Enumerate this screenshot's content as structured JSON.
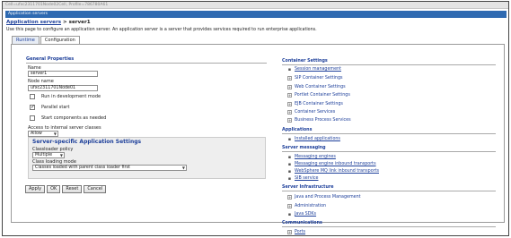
{
  "cell_path": "Cell=ufxc2311701Node02Cell, Profile=786780A61",
  "window_title": "Application servers",
  "breadcrumb": {
    "parent": "Application servers",
    "separator": " > ",
    "current": "server1"
  },
  "description": "Use this page to configure an application server. An application server is a server that provides services required to run enterprise applications.",
  "tabs": [
    {
      "label": "Runtime"
    },
    {
      "label": "Configuration"
    }
  ],
  "general": {
    "heading": "General Properties",
    "name_label": "Name",
    "name_value": "server1",
    "node_label": "Node name",
    "node_value": "ufxc2311701Node01",
    "dev_mode_label": "Run in development mode",
    "dev_mode_checked": false,
    "parallel_label": "Parallel start",
    "parallel_checked": true,
    "components_label": "Start components as needed",
    "components_checked": false,
    "access_label": "Access to internal server classes",
    "access_value": "Allow"
  },
  "server_specific": {
    "heading": "Server-specific Application Settings",
    "policy_label": "Classloader policy",
    "policy_value": "Multiple",
    "mode_label": "Class loading mode",
    "mode_value": "Classes loaded with parent class loader first"
  },
  "buttons": {
    "apply": "Apply",
    "ok": "OK",
    "reset": "Reset",
    "cancel": "Cancel"
  },
  "container_settings": {
    "heading": "Container Settings",
    "items": [
      {
        "label": "Session management",
        "type": "link"
      },
      {
        "label": "SIP Container Settings",
        "type": "expand"
      },
      {
        "label": "Web Container Settings",
        "type": "expand"
      },
      {
        "label": "Portlet Container Settings",
        "type": "expand"
      },
      {
        "label": "EJB Container Settings",
        "type": "expand"
      },
      {
        "label": "Container Services",
        "type": "expand"
      },
      {
        "label": "Business Process Services",
        "type": "expand"
      }
    ]
  },
  "applications": {
    "heading": "Applications",
    "items": [
      {
        "label": "Installed applications",
        "type": "link"
      }
    ]
  },
  "server_messaging": {
    "heading": "Server messaging",
    "items": [
      {
        "label": "Messaging engines",
        "type": "link"
      },
      {
        "label": "Messaging engine inbound transports",
        "type": "link"
      },
      {
        "label": "WebSphere MQ link inbound transports",
        "type": "link"
      },
      {
        "label": "SIB service",
        "type": "link"
      }
    ]
  },
  "server_infrastructure": {
    "heading": "Server Infrastructure",
    "items": [
      {
        "label": "Java and Process Management",
        "type": "expand"
      },
      {
        "label": "Administration",
        "type": "expand"
      },
      {
        "label": "Java SDKs",
        "type": "link"
      }
    ]
  },
  "communications": {
    "heading": "Communications",
    "items": [
      {
        "label": "Ports",
        "type": "expand"
      }
    ]
  }
}
